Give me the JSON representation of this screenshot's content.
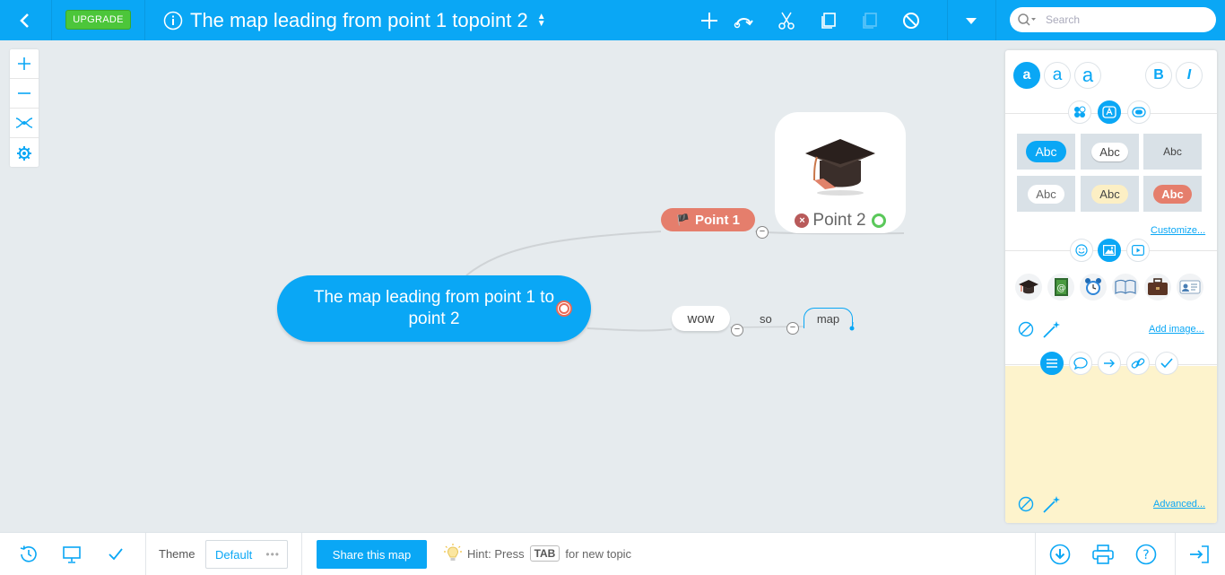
{
  "colors": {
    "accent": "#0aa7f5",
    "upgrade": "#4cc63a",
    "point1": "#e57e6c",
    "notes_bg": "#fdf3cc"
  },
  "topbar": {
    "back_icon": "chevron-left-icon",
    "upgrade_label": "UPGRADE",
    "info_icon": "info-icon",
    "title": "The map leading from point 1 topoint 2",
    "toolbar_icons": [
      "plus-icon",
      "connect-icon",
      "cut-icon",
      "copy-icon",
      "paste-icon",
      "block-icon",
      "dropdown-icon"
    ],
    "search_placeholder": "Search"
  },
  "zoombar": {
    "items": [
      "zoom-in-icon",
      "zoom-out-icon",
      "layout-icon",
      "settings-icon"
    ]
  },
  "map": {
    "central_topic": "The map leading from point 1 to point 2",
    "point1": "Point 1",
    "point2": "Point 2",
    "wow": "wow",
    "so": "so",
    "map": "map"
  },
  "right_panel": {
    "font_sizes": [
      "a",
      "a",
      "a"
    ],
    "bold": "B",
    "italic": "I",
    "style_tiles": [
      "Abc",
      "Abc",
      "Abc",
      "Abc",
      "Abc",
      "Abc"
    ],
    "customize_link": "Customize...",
    "add_image_link": "Add image...",
    "advanced_link": "Advanced..."
  },
  "bottombar": {
    "theme_label": "Theme",
    "theme_value": "Default",
    "share_label": "Share this map",
    "hint_prefix": "Hint: Press",
    "hint_key": "TAB",
    "hint_suffix": "for new topic"
  }
}
